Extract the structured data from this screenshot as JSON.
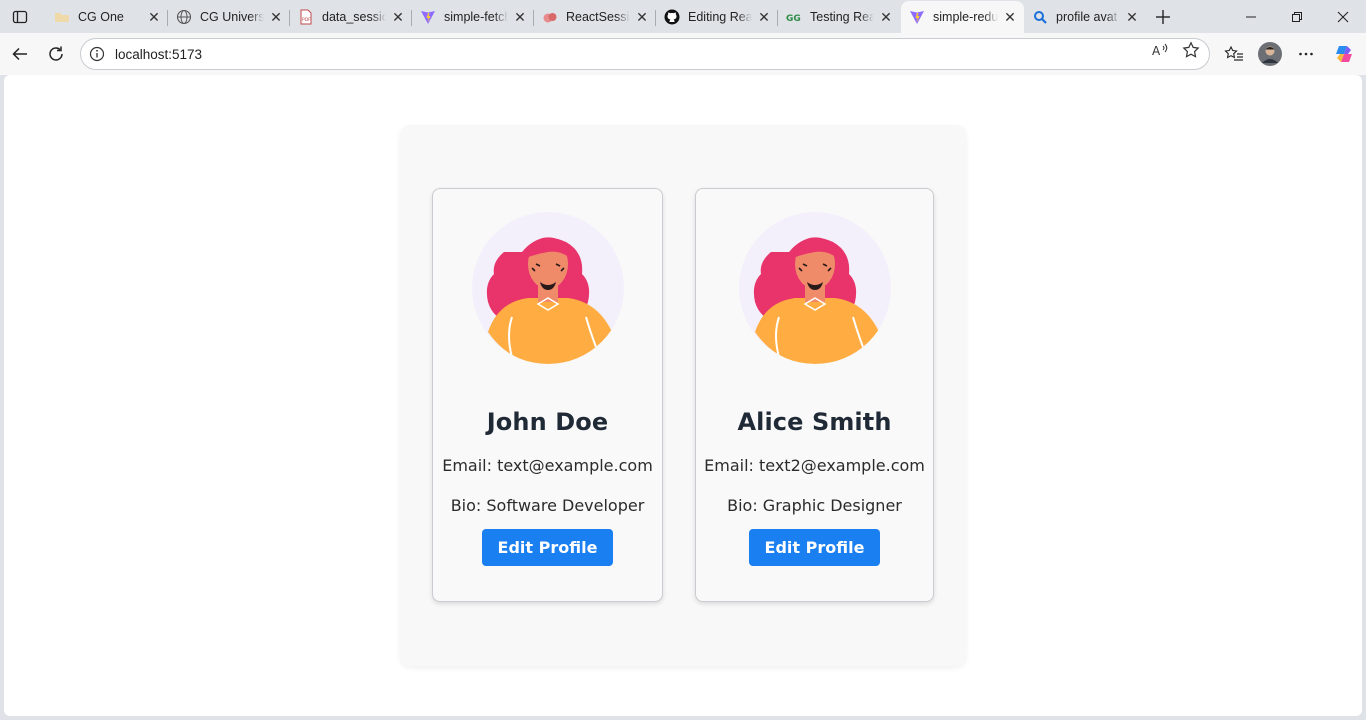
{
  "browser": {
    "tabs": [
      {
        "title": "CG One",
        "icon": "folder-icon",
        "active": false
      },
      {
        "title": "CG University",
        "icon": "globe-icon",
        "active": false
      },
      {
        "title": "data_session",
        "icon": "pdf-icon",
        "active": false
      },
      {
        "title": "simple-fetch",
        "icon": "vite-icon",
        "active": false
      },
      {
        "title": "ReactSession",
        "icon": "cloud-icon",
        "active": false
      },
      {
        "title": "Editing Rea",
        "icon": "github-icon",
        "active": false
      },
      {
        "title": "Testing Rea",
        "icon": "geeksforgeeks-icon",
        "active": false
      },
      {
        "title": "simple-redu",
        "icon": "vite-icon",
        "active": true
      },
      {
        "title": "profile avat",
        "icon": "search-icon",
        "active": false
      }
    ],
    "url": "localhost:5173"
  },
  "profiles": [
    {
      "name": "John Doe",
      "email": "Email: text@example.com",
      "bio": "Bio: Software Developer",
      "button": "Edit Profile"
    },
    {
      "name": "Alice Smith",
      "email": "Email: text2@example.com",
      "bio": "Bio: Graphic Designer",
      "button": "Edit Profile"
    }
  ],
  "colors": {
    "accent_button": "#1a7ff0",
    "avatar_hair": "#e8336b",
    "avatar_skin": "#f08b6a",
    "avatar_shirt": "#ffad42",
    "avatar_bg": "#f4f0fb"
  }
}
